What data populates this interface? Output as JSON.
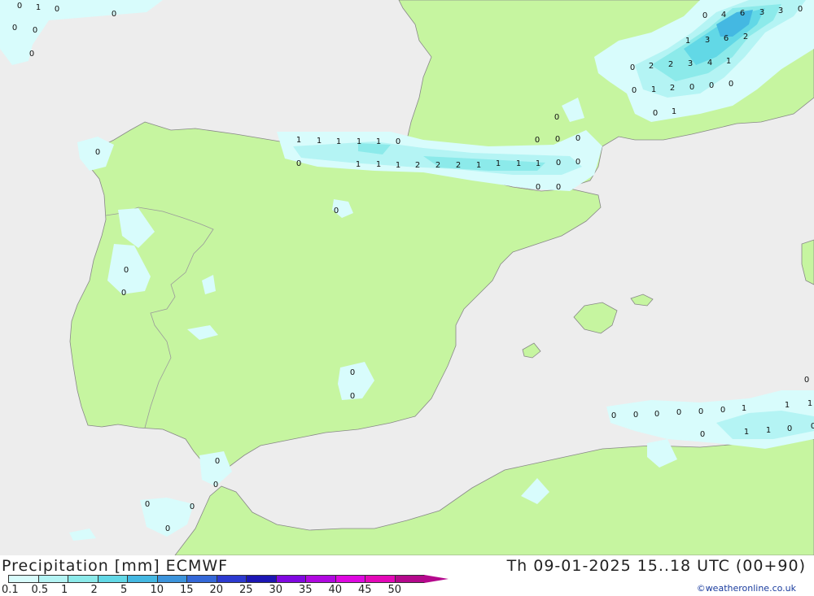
{
  "map": {
    "colors": {
      "sea": "#ededed",
      "land": "#c6f5a0",
      "border": "#9a9a9a",
      "coast": "#888888"
    },
    "value_labels": [
      "0",
      "1",
      "0",
      "0",
      "0",
      "0",
      "0",
      "0",
      "0",
      "0",
      "0",
      "0",
      "0",
      "0",
      "0",
      "0",
      "0",
      "0",
      "1",
      "1",
      "1",
      "1",
      "1",
      "0",
      "0",
      "1",
      "1",
      "1",
      "2",
      "2",
      "2",
      "1",
      "1",
      "1",
      "1",
      "0",
      "0",
      "0",
      "0",
      "0",
      "0",
      "0",
      "0",
      "0",
      "4",
      "6",
      "3",
      "3",
      "0",
      "1",
      "3",
      "6",
      "2",
      "0",
      "2",
      "2",
      "3",
      "4",
      "1",
      "0",
      "1",
      "2",
      "0",
      "0",
      "0",
      "0",
      "1",
      "0",
      "0",
      "0",
      "0",
      "0",
      "0",
      "1",
      "0",
      "1",
      "1",
      "0",
      "1",
      "0",
      "1",
      "0"
    ]
  },
  "footer": {
    "title_left": "Precipitation [mm] ECMWF",
    "title_right": "Th 09-01-2025 15..18 UTC (00+90)",
    "credit": "©weatheronline.co.uk",
    "legend": {
      "labels": [
        "0.1",
        "0.5",
        "1",
        "2",
        "5",
        "10",
        "15",
        "20",
        "25",
        "30",
        "35",
        "40",
        "45",
        "50"
      ],
      "colors": [
        "#d8fcfc",
        "#b4f4f4",
        "#8ceaea",
        "#62d8e6",
        "#44b8e2",
        "#3c94dc",
        "#3468d8",
        "#2c3ad0",
        "#1c16b4",
        "#8008e0",
        "#b008e0",
        "#de08e0",
        "#e408b8",
        "#b4088c"
      ]
    }
  }
}
